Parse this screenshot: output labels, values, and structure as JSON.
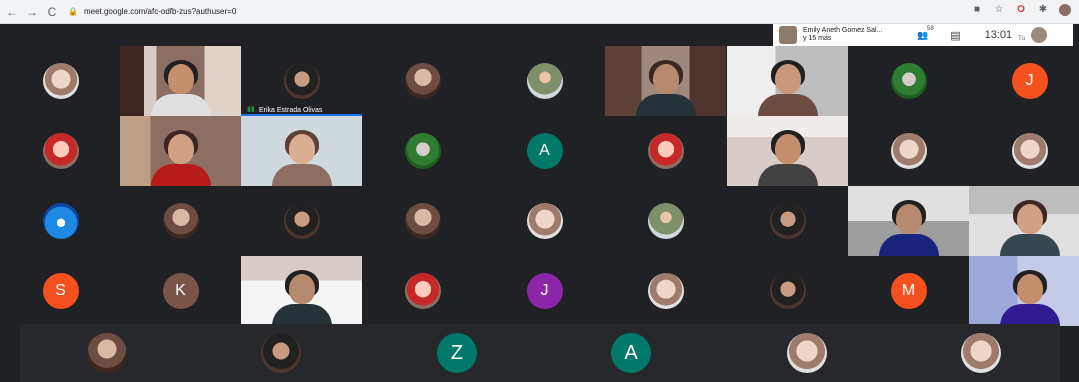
{
  "browser": {
    "url": "meet.google.com/afc-odfb-zus?authuser=0",
    "back_icon": "arrow-left-icon",
    "forward_icon": "arrow-right-icon",
    "reload_icon": "reload-icon"
  },
  "meet": {
    "presenter_name_line1": "Emily Aneth Gomez Sal...",
    "presenter_name_line2": "y 15 más",
    "people_count": "58",
    "clock": "13:01",
    "self_label": "Tú",
    "speaking_participant": "Erika Estrada Olivas"
  },
  "participants": {
    "letters": {
      "J_top": "J",
      "A_mid": "A",
      "S": "S",
      "K": "K",
      "J_purple": "J",
      "M": "M",
      "Z": "Z",
      "A_bottom": "A"
    }
  },
  "colors": {
    "meet_bg": "#202124",
    "orange": "#f4511e",
    "teal": "#00796b",
    "purple": "#8e24aa",
    "brown": "#795548",
    "speaking_blue": "#1a73e8"
  }
}
